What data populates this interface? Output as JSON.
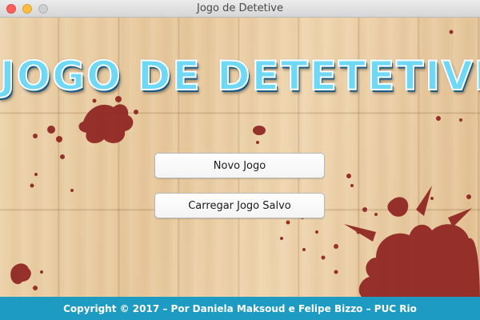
{
  "window": {
    "title": "Jogo de Detetive"
  },
  "game": {
    "title": "JOGO DE DETETETIVE"
  },
  "menu": {
    "new_game_label": "Novo Jogo",
    "load_game_label": "Carregar Jogo Salvo"
  },
  "footer": {
    "copyright": "Copyright © 2017 – Por Daniela Maksoud e Felipe Bizzo – PUC Rio"
  },
  "colors": {
    "title_fill": "#6fd8f4",
    "title_outline": "#1a5b84",
    "footer_bg": "#1e9bc3",
    "blood": "#8e2420",
    "wood": "#e9cfa6"
  },
  "icons": {
    "close": "traffic-light-close",
    "minimize": "traffic-light-minimize",
    "zoom": "traffic-light-zoom"
  }
}
